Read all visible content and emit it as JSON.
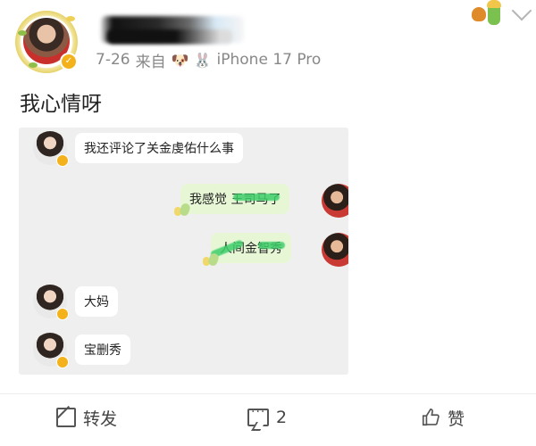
{
  "header": {
    "meta_time": "7-26",
    "meta_source_prefix": "来自",
    "meta_emojis": "🐶 🐰",
    "meta_device": "iPhone 17 Pro"
  },
  "post": {
    "text": "我心情呀"
  },
  "chat": {
    "messages": [
      {
        "side": "left",
        "text": "我还评论了关金虔佑什么事"
      },
      {
        "side": "right",
        "text": "我感觉 王司马了"
      },
      {
        "side": "right",
        "text": "人间金智秀"
      },
      {
        "side": "left",
        "text": "大妈"
      },
      {
        "side": "left",
        "text": "宝删秀"
      }
    ]
  },
  "actions": {
    "repost_label": "转发",
    "comment_count": "2",
    "like_label": "赞"
  },
  "colors": {
    "verified": "#f3b21b",
    "card_bg": "#efefef",
    "bubble_green": "#e7f7d6",
    "scribble": "#3ecf6b"
  }
}
